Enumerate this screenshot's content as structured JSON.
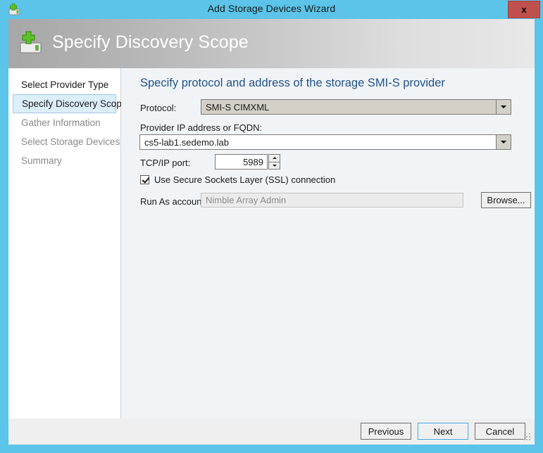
{
  "window": {
    "title": "Add Storage Devices Wizard",
    "icon": "storage-add-icon",
    "close_label": "x"
  },
  "header": {
    "title": "Specify Discovery Scope",
    "icon": "storage-add-icon"
  },
  "sidebar": {
    "items": [
      {
        "label": "Select Provider Type",
        "state": "done"
      },
      {
        "label": "Specify Discovery Scope",
        "state": "current"
      },
      {
        "label": "Gather Information",
        "state": "pending"
      },
      {
        "label": "Select Storage Devices",
        "state": "pending"
      },
      {
        "label": "Summary",
        "state": "pending"
      }
    ]
  },
  "content": {
    "heading": "Specify protocol and address of the storage SMI-S provider",
    "protocol": {
      "label": "Protocol:",
      "value": "SMI-S CIMXML",
      "arrow_icon": "chevron-down-icon"
    },
    "provider_address": {
      "label": "Provider IP address or FQDN:",
      "value": "cs5-lab1.sedemo.lab",
      "arrow_icon": "chevron-down-icon"
    },
    "port": {
      "label": "TCP/IP port:",
      "value": "5989",
      "up_icon": "chevron-up-icon",
      "down_icon": "chevron-down-icon"
    },
    "ssl": {
      "label": "Use Secure Sockets Layer (SSL) connection",
      "checked": true
    },
    "run_as": {
      "label": "Run As account:",
      "value": "Nimble Array Admin",
      "browse_label": "Browse..."
    }
  },
  "footer": {
    "previous_label": "Previous",
    "next_label": "Next",
    "cancel_label": "Cancel"
  },
  "colors": {
    "accent": "#5bc4e8",
    "heading": "#23518c",
    "close_button": "#c0504d",
    "focus_border": "#3c9fd9",
    "selected_nav_bg": "#ddeefb"
  }
}
